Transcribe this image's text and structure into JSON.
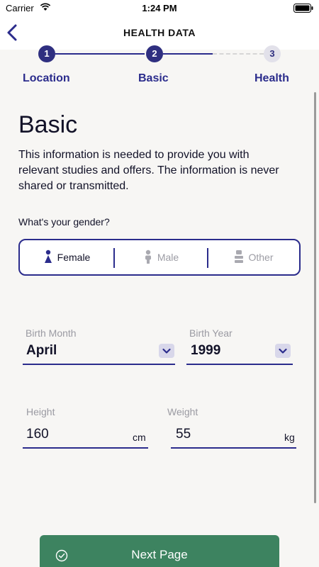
{
  "status_bar": {
    "carrier": "Carrier",
    "time": "1:24 PM"
  },
  "nav": {
    "title": "HEALTH DATA",
    "back_icon": "chevron-left-icon"
  },
  "stepper": {
    "steps": [
      {
        "number": "1",
        "label": "Location",
        "state": "done"
      },
      {
        "number": "2",
        "label": "Basic",
        "state": "current"
      },
      {
        "number": "3",
        "label": "Health",
        "state": "pending"
      }
    ]
  },
  "page": {
    "title": "Basic",
    "description": "This information is needed to provide you with relevant studies and offers. The information is never shared or transmitted."
  },
  "gender": {
    "question": "What's your gender?",
    "options": [
      {
        "label": "Female",
        "icon": "female-icon",
        "selected": true
      },
      {
        "label": "Male",
        "icon": "male-icon",
        "selected": false
      },
      {
        "label": "Other",
        "icon": "other-gender-icon",
        "selected": false
      }
    ]
  },
  "birth": {
    "month_label": "Birth Month",
    "month_value": "April",
    "year_label": "Birth Year",
    "year_value": "1999"
  },
  "measurements": {
    "height_label": "Height",
    "height_value": "160",
    "height_unit": "cm",
    "weight_label": "Weight",
    "weight_value": "55",
    "weight_unit": "kg"
  },
  "actions": {
    "next_label": "Next Page"
  },
  "colors": {
    "accent": "#2b2c8c",
    "button": "#3d8360",
    "background": "#f7f6f4"
  }
}
